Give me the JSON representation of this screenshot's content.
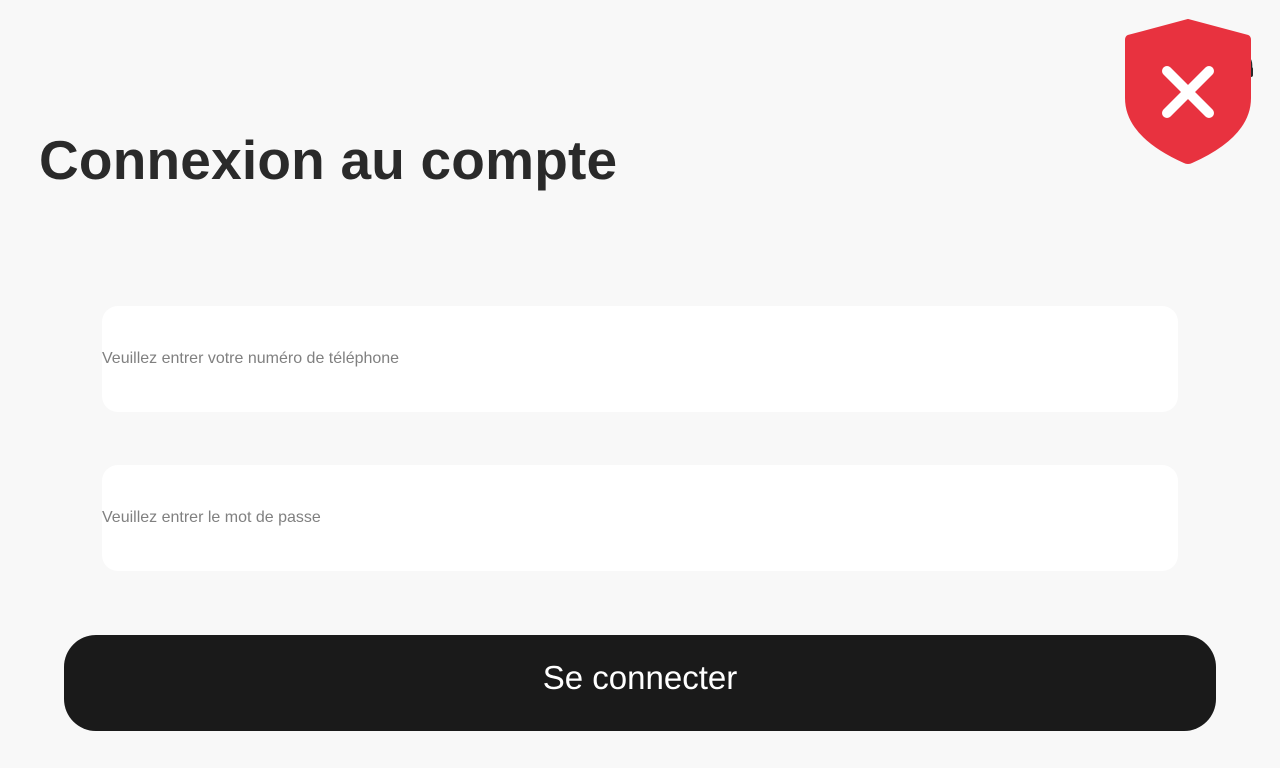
{
  "page": {
    "title": "Connexion au compte"
  },
  "form": {
    "phone": {
      "value": "",
      "placeholder": "Veuillez entrer votre numéro de téléphone"
    },
    "password": {
      "value": "",
      "placeholder": "Veuillez entrer le mot de passe"
    },
    "submit_label": "Se connecter"
  },
  "icons": {
    "support": "headset-icon",
    "security_warning": "shield-x-icon"
  },
  "colors": {
    "background": "#f8f8f8",
    "title_text": "#2a2a2a",
    "field_background": "#ffffff",
    "placeholder_text": "#808080",
    "button_background": "#1a1a1a",
    "button_text": "#ffffff",
    "shield_red": "#e8323f"
  }
}
